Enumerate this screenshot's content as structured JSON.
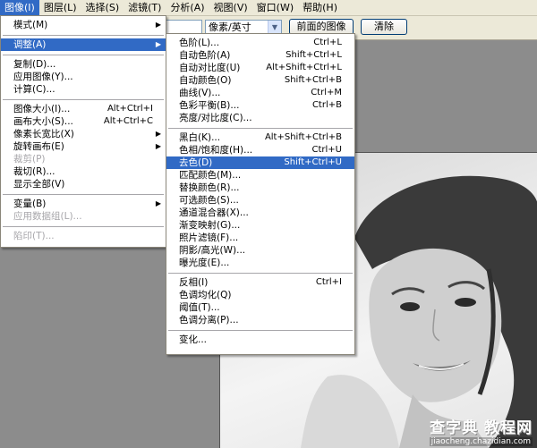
{
  "menubar": {
    "items": [
      "图像(I)",
      "图层(L)",
      "选择(S)",
      "滤镜(T)",
      "分析(A)",
      "视图(V)",
      "窗口(W)",
      "帮助(H)"
    ]
  },
  "optbar": {
    "unit_select": "像素/英寸",
    "front_image_button": "前面的图像",
    "clear_button": "清除"
  },
  "image_menu": {
    "items": [
      {
        "label": "模式(M)",
        "shortcut": "",
        "submenu": true
      },
      {
        "label": "调整(A)",
        "shortcut": "",
        "submenu": true,
        "highlighted": true
      },
      {
        "label": "复制(D)...",
        "shortcut": ""
      },
      {
        "label": "应用图像(Y)...",
        "shortcut": ""
      },
      {
        "label": "计算(C)...",
        "shortcut": ""
      },
      {
        "label": "图像大小(I)...",
        "shortcut": "Alt+Ctrl+I"
      },
      {
        "label": "画布大小(S)...",
        "shortcut": "Alt+Ctrl+C"
      },
      {
        "label": "像素长宽比(X)",
        "shortcut": "",
        "submenu": true
      },
      {
        "label": "旋转画布(E)",
        "shortcut": "",
        "submenu": true
      },
      {
        "label": "裁剪(P)",
        "shortcut": "",
        "disabled": true
      },
      {
        "label": "裁切(R)...",
        "shortcut": ""
      },
      {
        "label": "显示全部(V)",
        "shortcut": ""
      },
      {
        "label": "变量(B)",
        "shortcut": "",
        "submenu": true
      },
      {
        "label": "应用数据组(L)...",
        "shortcut": "",
        "disabled": true
      },
      {
        "label": "陷印(T)...",
        "shortcut": "",
        "disabled": true
      }
    ]
  },
  "adjust_menu": {
    "items": [
      {
        "label": "色阶(L)...",
        "shortcut": "Ctrl+L"
      },
      {
        "label": "自动色阶(A)",
        "shortcut": "Shift+Ctrl+L"
      },
      {
        "label": "自动对比度(U)",
        "shortcut": "Alt+Shift+Ctrl+L"
      },
      {
        "label": "自动颜色(O)",
        "shortcut": "Shift+Ctrl+B"
      },
      {
        "label": "曲线(V)...",
        "shortcut": "Ctrl+M"
      },
      {
        "label": "色彩平衡(B)...",
        "shortcut": "Ctrl+B"
      },
      {
        "label": "亮度/对比度(C)...",
        "shortcut": ""
      },
      {
        "label": "黑白(K)...",
        "shortcut": "Alt+Shift+Ctrl+B"
      },
      {
        "label": "色相/饱和度(H)...",
        "shortcut": "Ctrl+U"
      },
      {
        "label": "去色(D)",
        "shortcut": "Shift+Ctrl+U",
        "highlighted": true
      },
      {
        "label": "匹配颜色(M)...",
        "shortcut": ""
      },
      {
        "label": "替换颜色(R)...",
        "shortcut": ""
      },
      {
        "label": "可选颜色(S)...",
        "shortcut": ""
      },
      {
        "label": "通道混合器(X)...",
        "shortcut": ""
      },
      {
        "label": "渐变映射(G)...",
        "shortcut": ""
      },
      {
        "label": "照片滤镜(F)...",
        "shortcut": ""
      },
      {
        "label": "阴影/高光(W)...",
        "shortcut": ""
      },
      {
        "label": "曝光度(E)...",
        "shortcut": ""
      },
      {
        "label": "反相(I)",
        "shortcut": "Ctrl+I"
      },
      {
        "label": "色调均化(Q)",
        "shortcut": ""
      },
      {
        "label": "阈值(T)...",
        "shortcut": ""
      },
      {
        "label": "色调分离(P)...",
        "shortcut": ""
      },
      {
        "label": "变化...",
        "shortcut": ""
      }
    ]
  },
  "watermark": {
    "title": "查字典 教程网",
    "url": "jiaocheng.chazidian.com"
  },
  "colors": {
    "menu_highlight": "#316ac5",
    "menubar_bg": "#ece9d8",
    "workspace_bg": "#8c8c8c"
  }
}
